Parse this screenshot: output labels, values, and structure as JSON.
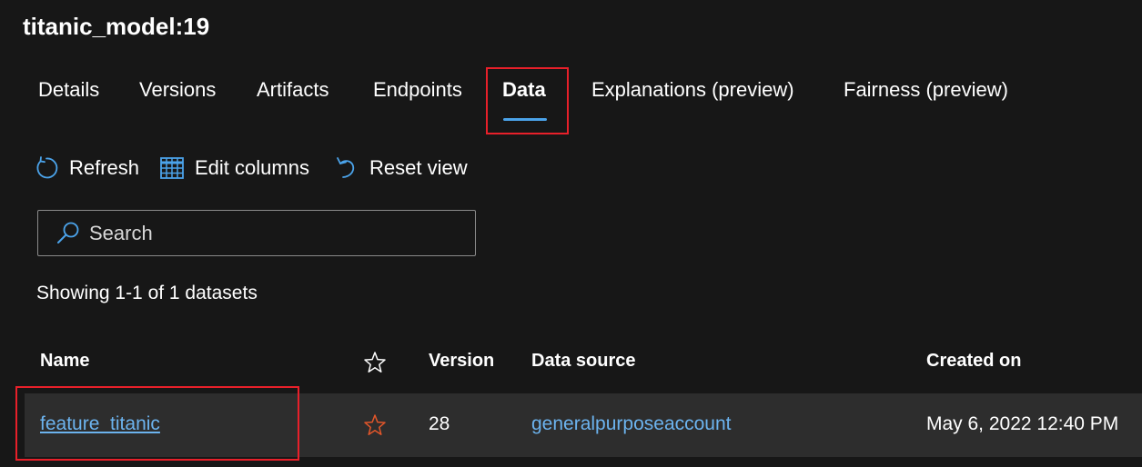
{
  "page": {
    "title": "titanic_model:19"
  },
  "tabs": [
    {
      "label": "Details",
      "active": false
    },
    {
      "label": "Versions",
      "active": false
    },
    {
      "label": "Artifacts",
      "active": false
    },
    {
      "label": "Endpoints",
      "active": false
    },
    {
      "label": "Data",
      "active": true
    },
    {
      "label": "Explanations (preview)",
      "active": false
    },
    {
      "label": "Fairness (preview)",
      "active": false
    }
  ],
  "toolbar": {
    "refresh_label": "Refresh",
    "refresh_icon": "refresh-icon",
    "edit_columns_label": "Edit columns",
    "edit_columns_icon": "table-icon",
    "reset_view_label": "Reset view",
    "reset_view_icon": "undo-icon"
  },
  "search": {
    "placeholder": "Search",
    "value": "",
    "icon": "search-icon"
  },
  "summary": {
    "showing_text": "Showing 1-1 of 1 datasets"
  },
  "table": {
    "columns": {
      "name": "Name",
      "favorite_icon": "star-outline-icon",
      "version": "Version",
      "data_source": "Data source",
      "created_on": "Created on"
    },
    "rows": [
      {
        "name": "feature_titanic",
        "favorite": false,
        "version": "28",
        "data_source": "generalpurposeaccount",
        "created_on": "May 6, 2022 12:40 PM"
      }
    ]
  },
  "colors": {
    "background": "#171717",
    "row_background": "#2d2d2d",
    "accent": "#4ba3ea",
    "link": "#6cb3ee",
    "highlight_box": "#e8202a",
    "favorite_star": "#e3562a"
  }
}
